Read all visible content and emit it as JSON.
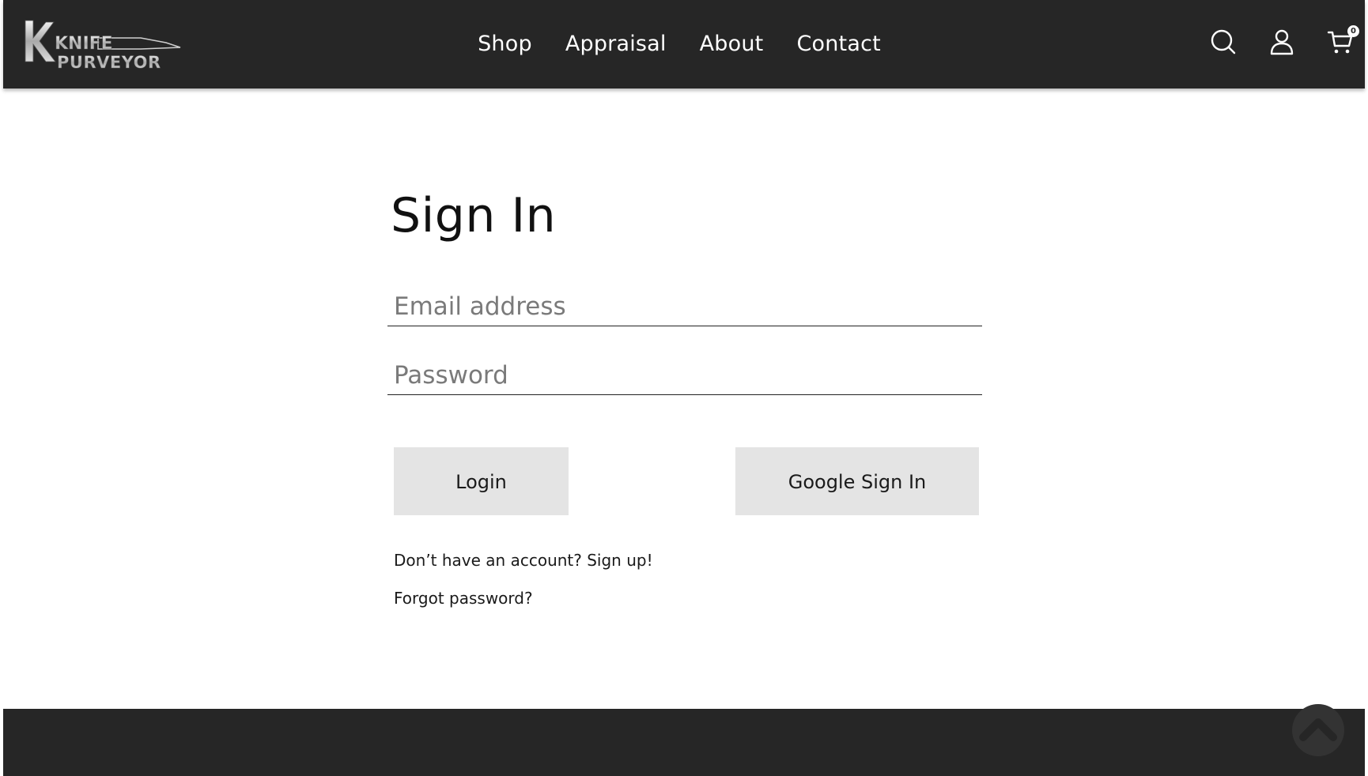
{
  "header": {
    "logo_text_top": "KNIFE",
    "logo_text_bottom": "PURVEYOR",
    "nav": [
      {
        "label": "Shop"
      },
      {
        "label": "Appraisal"
      },
      {
        "label": "About"
      },
      {
        "label": "Contact"
      }
    ],
    "icons": {
      "search": "search-icon",
      "account": "user-icon",
      "cart": "cart-icon"
    },
    "cart_count": "0"
  },
  "signin": {
    "title": "Sign In",
    "email_placeholder": "Email address",
    "email_value": "",
    "password_placeholder": "Password",
    "password_value": "",
    "login_label": "Login",
    "google_label": "Google Sign In",
    "signup_text": "Don’t have an account? Sign up!",
    "forgot_text": "Forgot password?"
  },
  "footer": {
    "back_to_top_icon": "chevron-up-icon"
  },
  "colors": {
    "header_bg": "#262626",
    "button_bg": "#e4e4e4",
    "text": "#1a1a1a",
    "placeholder": "#7a7a7a"
  }
}
